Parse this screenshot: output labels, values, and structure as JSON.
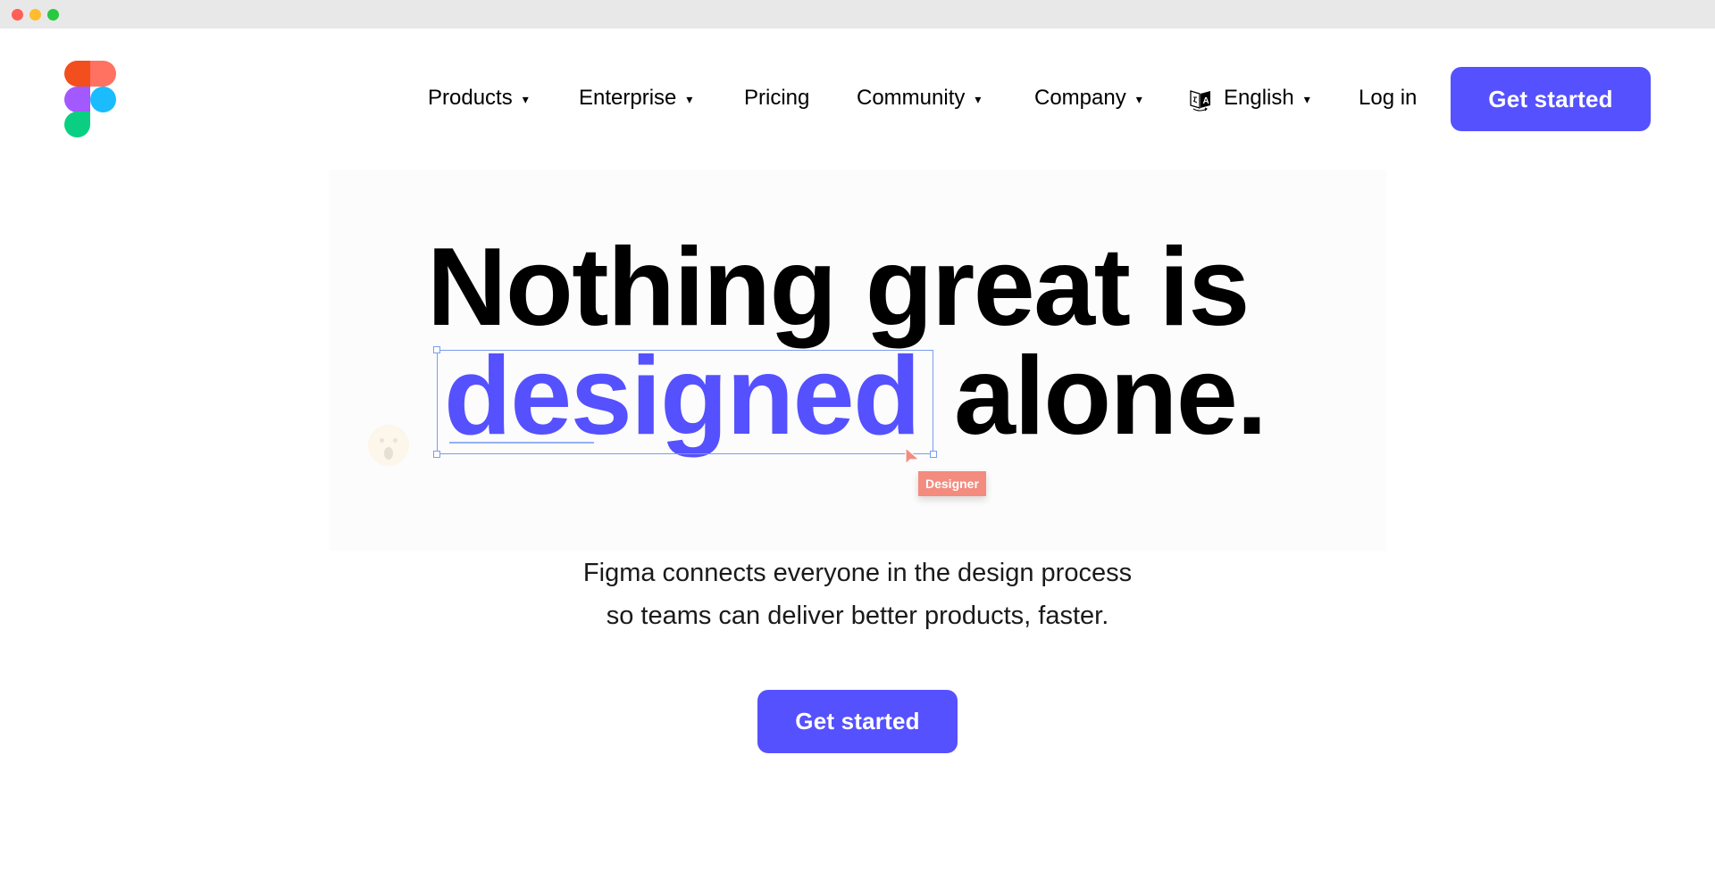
{
  "window": {
    "controls": [
      "close",
      "minimize",
      "maximize"
    ]
  },
  "brand": {
    "logo": "figma-logo",
    "colors": {
      "red": "#F24E1E",
      "coral": "#FF7262",
      "purple": "#A259FF",
      "blue": "#1ABCFE",
      "green": "#0ACF83",
      "accent": "#5551FF"
    }
  },
  "nav": {
    "items": [
      {
        "label": "Products",
        "dropdown": true
      },
      {
        "label": "Enterprise",
        "dropdown": true
      },
      {
        "label": "Pricing",
        "dropdown": false
      },
      {
        "label": "Community",
        "dropdown": true
      },
      {
        "label": "Company",
        "dropdown": true
      }
    ],
    "language": {
      "icon": "translate-icon",
      "label": "English",
      "dropdown": true
    },
    "login_label": "Log in",
    "cta_label": "Get started",
    "caret": "▾"
  },
  "hero": {
    "headline_line1": "Nothing great is",
    "headline_highlight": "designed",
    "headline_rest": "alone.",
    "cursor_label": "Designer",
    "subtitle_line1": "Figma connects everyone in the design process",
    "subtitle_line2": "so teams can deliver better products, faster.",
    "cta_label": "Get started"
  }
}
